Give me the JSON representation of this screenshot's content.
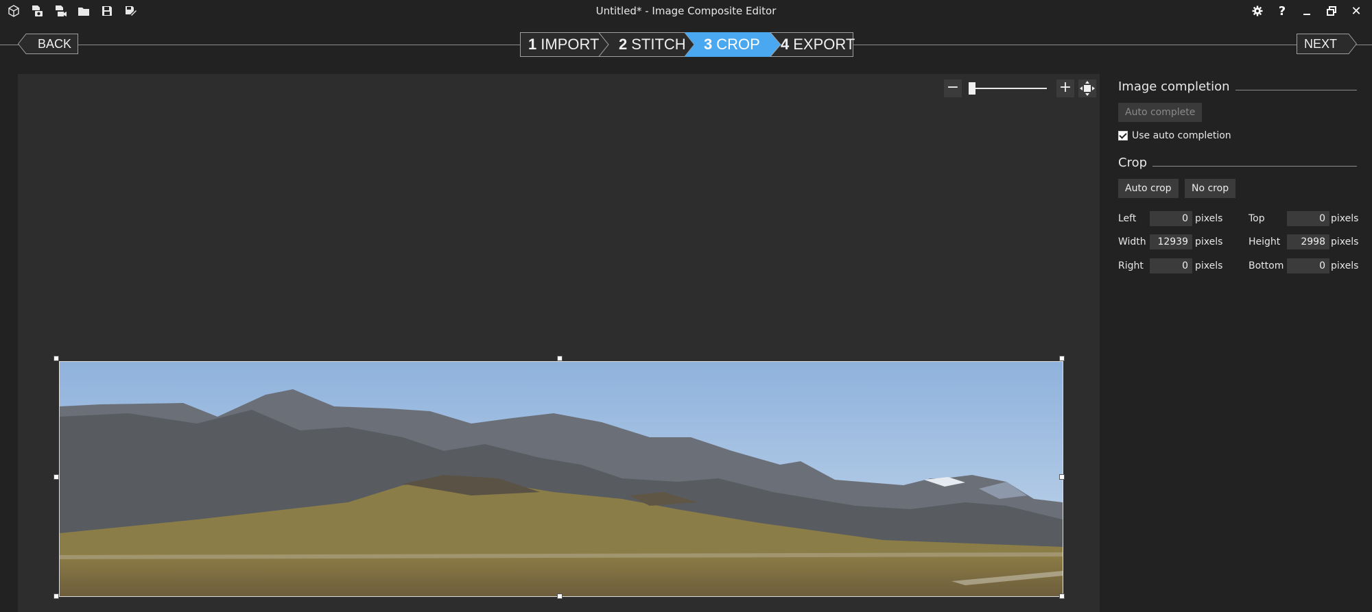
{
  "window": {
    "title": "Untitled* - Image Composite Editor"
  },
  "toolbar": {
    "icons": [
      "app-cube-icon",
      "new-panorama-icon",
      "new-video-panorama-icon",
      "open-folder-icon",
      "save-icon",
      "save-as-icon"
    ]
  },
  "window_controls": {
    "settings_icon": "gear-icon",
    "help_label": "?",
    "minimize_icon": "minimize-icon",
    "restore_icon": "restore-icon",
    "close_label": "✕"
  },
  "nav": {
    "back_label": "BACK",
    "next_label": "NEXT",
    "steps": [
      {
        "num": "1",
        "label": "IMPORT",
        "active": false
      },
      {
        "num": "2",
        "label": "STITCH",
        "active": false
      },
      {
        "num": "3",
        "label": "CROP",
        "active": true
      },
      {
        "num": "4",
        "label": "EXPORT",
        "active": false
      }
    ],
    "active_color": "#4aa8f0"
  },
  "zoom": {
    "minus_label": "−",
    "plus_label": "+",
    "fit_icon": "fit-to-window-icon",
    "level": 0
  },
  "panel": {
    "image_completion": {
      "heading": "Image completion",
      "auto_complete_label": "Auto complete",
      "use_auto_completion_label": "Use auto completion",
      "use_auto_completion_checked": true
    },
    "crop": {
      "heading": "Crop",
      "auto_crop_label": "Auto crop",
      "no_crop_label": "No crop",
      "unit": "pixels",
      "fields": {
        "left": {
          "label": "Left",
          "value": "0"
        },
        "top": {
          "label": "Top",
          "value": "0"
        },
        "width": {
          "label": "Width",
          "value": "12939"
        },
        "height": {
          "label": "Height",
          "value": "2998"
        },
        "right": {
          "label": "Right",
          "value": "0"
        },
        "bottom": {
          "label": "Bottom",
          "value": "0"
        }
      }
    }
  }
}
